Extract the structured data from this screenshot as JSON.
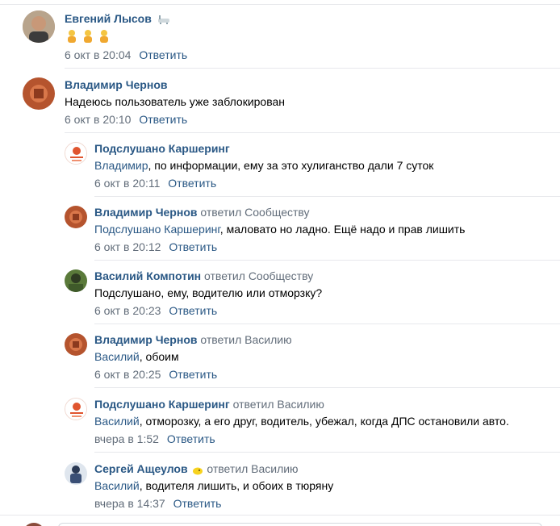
{
  "comments": [
    {
      "author": "Евгений Лысов",
      "author_badge_icon": "bathtub-icon",
      "emoji": [
        "woman-golfer-icon",
        "woman-golfer-icon",
        "woman-golfer-icon"
      ],
      "text": "",
      "date": "6 окт в 20:04",
      "reply_label": "Ответить"
    },
    {
      "author": "Владимир Чернов",
      "text": "Надеюсь пользователь уже заблокирован",
      "date": "6 окт в 20:10",
      "reply_label": "Ответить"
    },
    {
      "author": "Подслушано Каршеринг",
      "mention": "Владимир",
      "text": ", по информации, ему за это хулиганство дали 7 суток",
      "date": "6 окт в 20:11",
      "reply_label": "Ответить"
    },
    {
      "author": "Владимир Чернов",
      "replied_to": "ответил Сообществу",
      "mention": "Подслушано Каршеринг",
      "text": ", маловато но ладно. Ещё надо и прав лишить",
      "date": "6 окт в 20:12",
      "reply_label": "Ответить"
    },
    {
      "author": "Василий Компотин",
      "replied_to": "ответил Сообществу",
      "text": "Подслушано, ему, водителю или отморзку?",
      "date": "6 окт в 20:23",
      "reply_label": "Ответить"
    },
    {
      "author": "Владимир Чернов",
      "replied_to": "ответил Василию",
      "mention": "Василий",
      "text": ", обоим",
      "date": "6 окт в 20:25",
      "reply_label": "Ответить"
    },
    {
      "author": "Подслушано Каршеринг",
      "replied_to": "ответил Василию",
      "mention": "Василий",
      "text": ", отморозку, а его друг, водитель, убежал, когда ДПС остановили авто.",
      "date": "вчера в 1:52",
      "reply_label": "Ответить"
    },
    {
      "author": "Сергей Ащеулов",
      "author_badge_icon": "lemon-icon",
      "replied_to": "ответил Василию",
      "mention": "Василий",
      "text": ", водителя лишить, и обоих в тюряну",
      "date": "вчера в 14:37",
      "reply_label": "Ответить"
    }
  ],
  "colors": {
    "link": "#2a5885",
    "meta": "#626d7a",
    "divider": "#e7e8ec"
  }
}
